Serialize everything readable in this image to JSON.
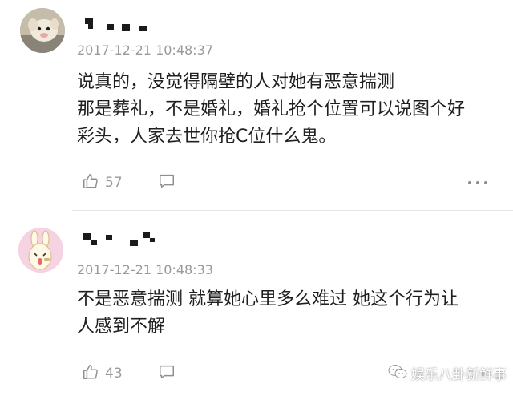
{
  "comments": [
    {
      "timestamp": "2017-12-21 10:48:37",
      "lines": [
        "说真的，没觉得隔壁的人对她有恶意揣测",
        "那是葬礼，不是婚礼，婚礼抢个位置可以说图个好",
        "彩头，人家去世你抢C位什么鬼。"
      ],
      "likes": "57"
    },
    {
      "timestamp": "2017-12-21 10:48:33",
      "lines": [
        "不是恶意揣测 就算她心里多么难过 她这个行为让",
        "人感到不解"
      ],
      "likes": "43"
    }
  ],
  "watermark": {
    "text": "娱乐八卦新鲜事",
    "icon": "wechat-icon"
  },
  "icons": {
    "like": "thumbs-up-icon",
    "reply": "comment-bubble-icon",
    "more": "more-dots-icon"
  }
}
